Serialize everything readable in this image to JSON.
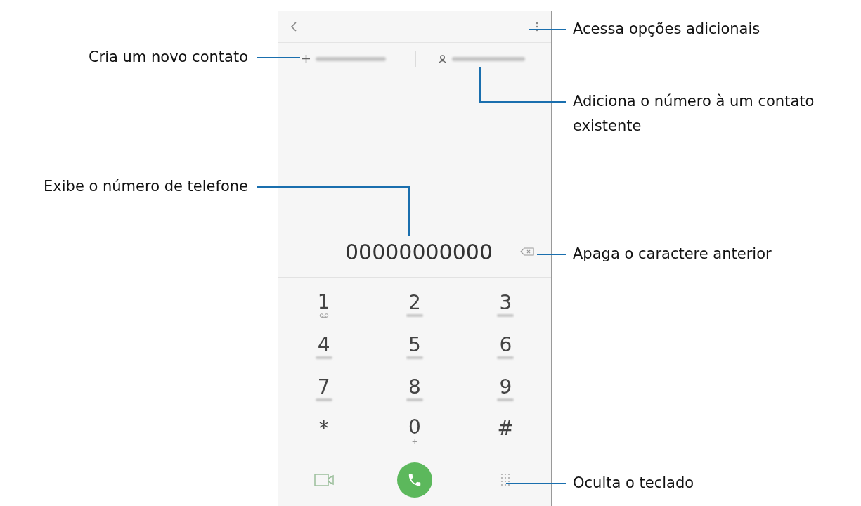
{
  "callouts_left": [
    {
      "text": "Cria um novo contato"
    },
    {
      "text": "Exibe o número de telefone"
    }
  ],
  "callouts_right": [
    {
      "text": "Acessa opções adicionais"
    },
    {
      "text": "Adiciona o número à um contato existente"
    },
    {
      "text": "Apaga o caractere anterior"
    },
    {
      "text": "Oculta o teclado"
    }
  ],
  "phone": {
    "number": "00000000000",
    "keys": [
      {
        "digit": "1",
        "kind": "voicemail"
      },
      {
        "digit": "2",
        "kind": "blurred"
      },
      {
        "digit": "3",
        "kind": "blurred"
      },
      {
        "digit": "4",
        "kind": "blurred"
      },
      {
        "digit": "5",
        "kind": "blurred"
      },
      {
        "digit": "6",
        "kind": "blurred"
      },
      {
        "digit": "7",
        "kind": "blurred"
      },
      {
        "digit": "8",
        "kind": "blurred"
      },
      {
        "digit": "9",
        "kind": "blurred"
      },
      {
        "digit": "*",
        "kind": "none"
      },
      {
        "digit": "0",
        "kind": "text",
        "sub": "+"
      },
      {
        "digit": "#",
        "kind": "none"
      }
    ]
  }
}
